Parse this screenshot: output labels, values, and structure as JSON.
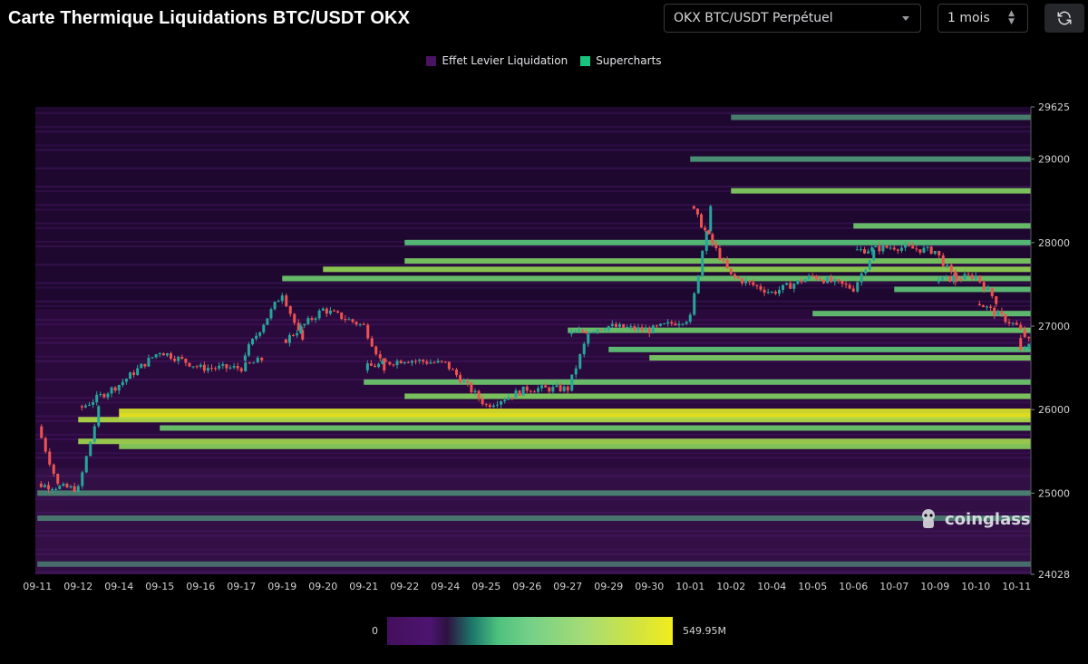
{
  "header": {
    "title": "Carte Thermique Liquidations BTC/USDT OKX",
    "exchange_select": "OKX BTC/USDT Perpétuel",
    "period_select": "1 mois",
    "refresh_icon": "refresh-icon"
  },
  "watermark": "coinglass",
  "colorbar": {
    "min_label": "0",
    "max_label": "549.95M"
  },
  "colors": {
    "background": "#000000",
    "low": "#44105c",
    "mid": "#4fc27f",
    "high": "#f2ec1c",
    "candle_up": "#26a69a",
    "candle_down": "#ef5350"
  },
  "chart_data": {
    "type": "heatmap",
    "title": "Carte Thermique Liquidations BTC/USDT OKX",
    "legend": [
      {
        "name": "Effet Levier Liquidation",
        "color": "#4a1363"
      },
      {
        "name": "Supercharts",
        "color": "#19c37d"
      }
    ],
    "x_ticks": [
      "09-11",
      "09-12",
      "09-14",
      "09-15",
      "09-16",
      "09-17",
      "09-19",
      "09-20",
      "09-21",
      "09-22",
      "09-24",
      "09-25",
      "09-26",
      "09-27",
      "09-29",
      "09-30",
      "10-01",
      "10-02",
      "10-04",
      "10-05",
      "10-06",
      "10-07",
      "10-09",
      "10-10",
      "10-11"
    ],
    "y_ticks": [
      24028,
      25000,
      26000,
      27000,
      28000,
      29000,
      29625
    ],
    "ylim": [
      24028,
      29625
    ],
    "y_axis_side": "right",
    "liquidation_levels": [
      {
        "price": 25920,
        "intensity": 1.0,
        "from": "09-14"
      },
      {
        "price": 25980,
        "intensity": 0.92,
        "from": "09-14"
      },
      {
        "price": 25880,
        "intensity": 0.78,
        "from": "09-12"
      },
      {
        "price": 25620,
        "intensity": 0.72,
        "from": "09-12"
      },
      {
        "price": 25560,
        "intensity": 0.65,
        "from": "09-14"
      },
      {
        "price": 25780,
        "intensity": 0.55,
        "from": "09-15"
      },
      {
        "price": 26160,
        "intensity": 0.62,
        "from": "09-22"
      },
      {
        "price": 26330,
        "intensity": 0.55,
        "from": "09-21"
      },
      {
        "price": 26620,
        "intensity": 0.6,
        "from": "09-30"
      },
      {
        "price": 26720,
        "intensity": 0.5,
        "from": "09-29"
      },
      {
        "price": 26950,
        "intensity": 0.55,
        "from": "09-27"
      },
      {
        "price": 27150,
        "intensity": 0.52,
        "from": "10-05"
      },
      {
        "price": 27570,
        "intensity": 0.55,
        "from": "09-19"
      },
      {
        "price": 27680,
        "intensity": 0.68,
        "from": "09-20"
      },
      {
        "price": 27780,
        "intensity": 0.6,
        "from": "09-22"
      },
      {
        "price": 27440,
        "intensity": 0.5,
        "from": "10-07"
      },
      {
        "price": 28000,
        "intensity": 0.48,
        "from": "09-22"
      },
      {
        "price": 28200,
        "intensity": 0.55,
        "from": "10-06"
      },
      {
        "price": 28620,
        "intensity": 0.62,
        "from": "10-02"
      },
      {
        "price": 29000,
        "intensity": 0.35,
        "from": "10-01"
      },
      {
        "price": 29500,
        "intensity": 0.3,
        "from": "10-02"
      },
      {
        "price": 25000,
        "intensity": 0.3,
        "from": "09-11"
      },
      {
        "price": 24700,
        "intensity": 0.28,
        "from": "09-11"
      },
      {
        "price": 24150,
        "intensity": 0.25,
        "from": "09-11"
      }
    ],
    "price_path": [
      {
        "date": "09-11",
        "price": 25800
      },
      {
        "date": "09-11",
        "price": 25100
      },
      {
        "date": "09-12",
        "price": 25050
      },
      {
        "date": "09-12",
        "price": 26000
      },
      {
        "date": "09-14",
        "price": 26300
      },
      {
        "date": "09-15",
        "price": 26700
      },
      {
        "date": "09-16",
        "price": 26500
      },
      {
        "date": "09-17",
        "price": 26500
      },
      {
        "date": "09-17",
        "price": 26600
      },
      {
        "date": "09-19",
        "price": 27400
      },
      {
        "date": "09-19",
        "price": 26800
      },
      {
        "date": "09-20",
        "price": 27200
      },
      {
        "date": "09-21",
        "price": 27000
      },
      {
        "date": "09-21",
        "price": 26500
      },
      {
        "date": "09-22",
        "price": 26600
      },
      {
        "date": "09-24",
        "price": 26550
      },
      {
        "date": "09-25",
        "price": 26050
      },
      {
        "date": "09-26",
        "price": 26250
      },
      {
        "date": "09-27",
        "price": 26250
      },
      {
        "date": "09-27",
        "price": 26900
      },
      {
        "date": "09-29",
        "price": 27000
      },
      {
        "date": "09-30",
        "price": 26950
      },
      {
        "date": "10-01",
        "price": 27100
      },
      {
        "date": "10-01",
        "price": 28450
      },
      {
        "date": "10-02",
        "price": 27600
      },
      {
        "date": "10-04",
        "price": 27400
      },
      {
        "date": "10-05",
        "price": 27600
      },
      {
        "date": "10-06",
        "price": 27450
      },
      {
        "date": "10-06",
        "price": 27900
      },
      {
        "date": "10-07",
        "price": 27950
      },
      {
        "date": "10-09",
        "price": 27900
      },
      {
        "date": "10-09",
        "price": 27550
      },
      {
        "date": "10-10",
        "price": 27600
      },
      {
        "date": "10-10",
        "price": 27300
      },
      {
        "date": "10-11",
        "price": 27000
      },
      {
        "date": "10-11",
        "price": 26700
      },
      {
        "date": "10-11",
        "price": 26850
      }
    ]
  }
}
